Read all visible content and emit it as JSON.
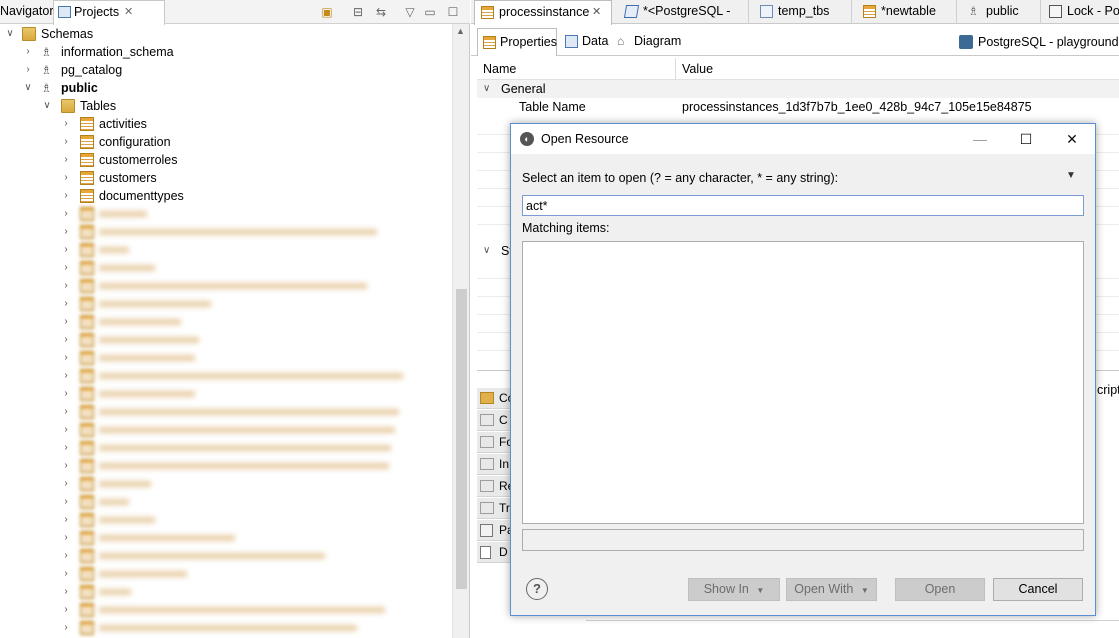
{
  "left_panel": {
    "tabs": [
      {
        "label": "Navigator"
      },
      {
        "label": "Projects"
      }
    ],
    "tree": {
      "schemas_label": "Schemas",
      "schemas": [
        {
          "label": "information_schema"
        },
        {
          "label": "pg_catalog"
        },
        {
          "label": "public"
        }
      ],
      "tables_label": "Tables",
      "tables": [
        {
          "label": "activities"
        },
        {
          "label": "configuration"
        },
        {
          "label": "customerroles"
        },
        {
          "label": "customers"
        },
        {
          "label": "documenttypes"
        }
      ]
    }
  },
  "right_panel": {
    "editor_tabs": [
      {
        "label": "processinstance"
      },
      {
        "label": "*<PostgreSQL -"
      },
      {
        "label": "temp_tbs"
      },
      {
        "label": "*newtable"
      },
      {
        "label": "public"
      },
      {
        "label": "Lock - Po"
      }
    ],
    "sub_tabs": [
      {
        "label": "Properties"
      },
      {
        "label": "Data"
      },
      {
        "label": "Diagram"
      }
    ],
    "connection_label": "PostgreSQL - playground",
    "columns": {
      "name": "Name",
      "value": "Value"
    },
    "general_group": "General",
    "table_name_label": "Table Name",
    "table_name_value": "processinstances_1d3f7b7b_1ee0_428b_94c7_105e15e84875",
    "second_group": "St",
    "side_items": [
      "Co",
      "C",
      "Fo",
      "In",
      "Re",
      "Tr",
      "Pa",
      "D"
    ],
    "right_edge_text": "cript"
  },
  "dialog": {
    "title": "Open Resource",
    "prompt": "Select an item to open (? = any character, * = any string):",
    "search_value": "act*",
    "matching_label": "Matching items:",
    "buttons": {
      "show_in": "Show In",
      "open_with": "Open With",
      "open": "Open",
      "cancel": "Cancel"
    },
    "help": "?"
  }
}
